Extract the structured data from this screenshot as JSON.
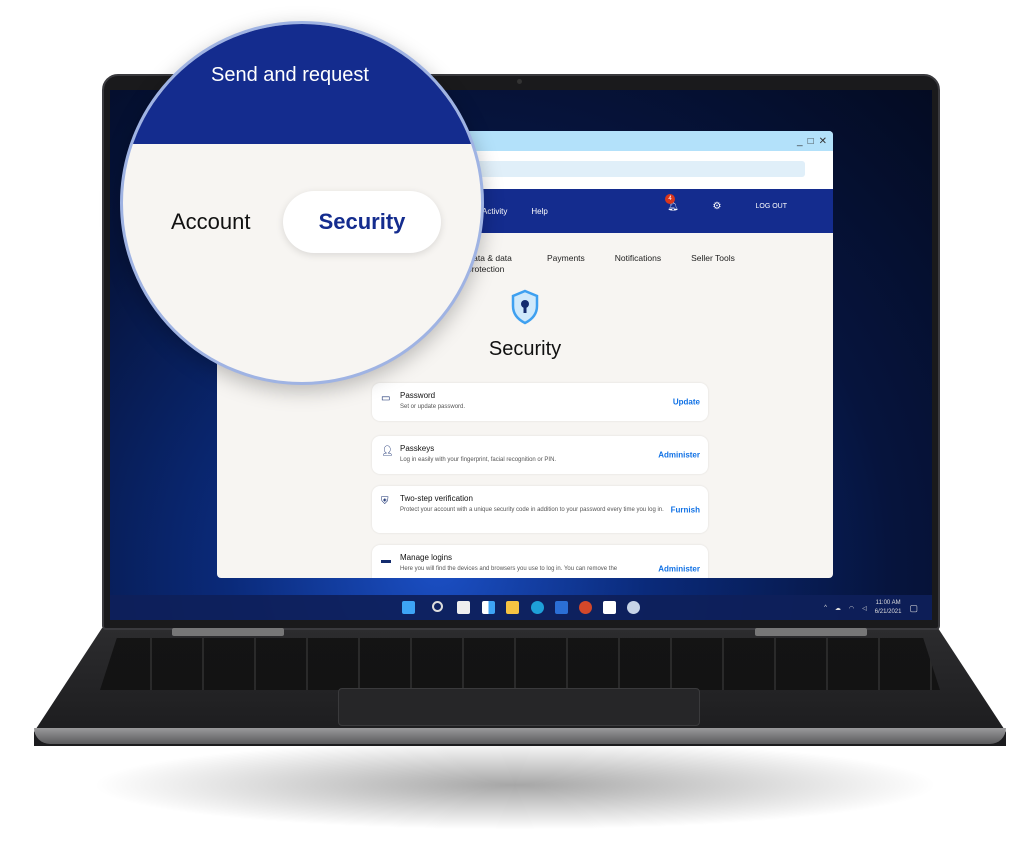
{
  "app": {
    "window_controls": [
      "_",
      "□",
      "✕"
    ],
    "nav": {
      "items": [
        "Activity",
        "Help"
      ],
      "notification_count": "4",
      "logout": "LOG OUT"
    },
    "subtabs": [
      "Data & data protection",
      "Payments",
      "Notifications",
      "Seller Tools"
    ],
    "page_title": "Security",
    "cards": [
      {
        "title": "Password",
        "desc": "Set or update password.",
        "action": "Update",
        "icon": "password-icon"
      },
      {
        "title": "Passkeys",
        "desc": "Log in easily with your fingerprint, facial recognition or PIN.",
        "action": "Administer",
        "icon": "user-key-icon"
      },
      {
        "title": "Two-step verification",
        "desc": "Protect your account with a unique security code in addition to your password every time you log in.",
        "action": "Furnish",
        "icon": "shield-check-icon"
      },
      {
        "title": "Manage logins",
        "desc": "Here you will find the devices and browsers you use to log in. You can remove the",
        "action": "Administer",
        "icon": "laptop-icon"
      }
    ]
  },
  "magnifier": {
    "top": "Send and request",
    "account": "Account",
    "security": "Security"
  },
  "taskbar": {
    "time": "11:00 AM",
    "date": "6/21/2021"
  },
  "colors": {
    "brand": "#142c8e",
    "link": "#1071e5",
    "titlebar": "#b3e1fa",
    "badge": "#d9361c"
  }
}
